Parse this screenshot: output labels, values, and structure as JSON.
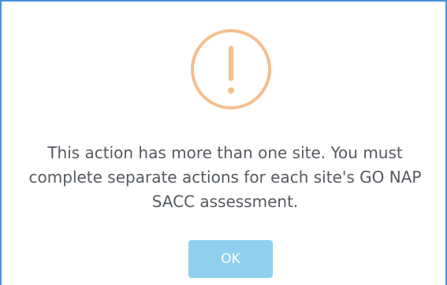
{
  "dialog": {
    "icon": "warning-exclamation-icon",
    "message": "This action has more than one site. You must complete separate actions for each site's GO NAP SACC assessment.",
    "ok_label": "OK"
  },
  "colors": {
    "icon_orange": "#f4be8d",
    "button_blue": "#8fd0ef",
    "frame_blue": "#4a8fd8",
    "text_gray": "#555a60"
  }
}
